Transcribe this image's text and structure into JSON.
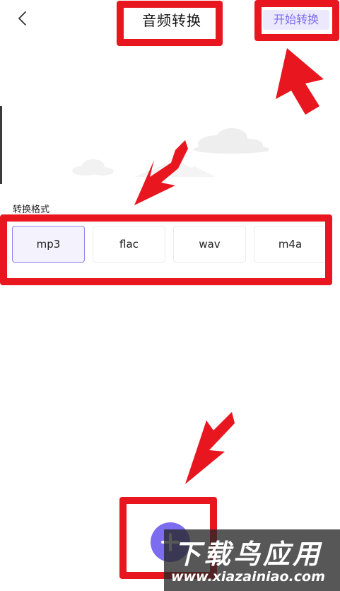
{
  "header": {
    "title": "音频转换",
    "start_label": "开始转换"
  },
  "format": {
    "label": "转换格式",
    "options": [
      "mp3",
      "flac",
      "wav",
      "m4a"
    ],
    "selected": "mp3"
  },
  "colors": {
    "accent": "#7b6cf0",
    "accent_bg": "#ece9ff",
    "annotation_red": "#e8161e"
  },
  "icons": {
    "back": "chevron-left-icon",
    "add": "plus-icon"
  },
  "watermark": {
    "main": "下载鸟应用",
    "sub": "www.xiazainiao.com"
  }
}
